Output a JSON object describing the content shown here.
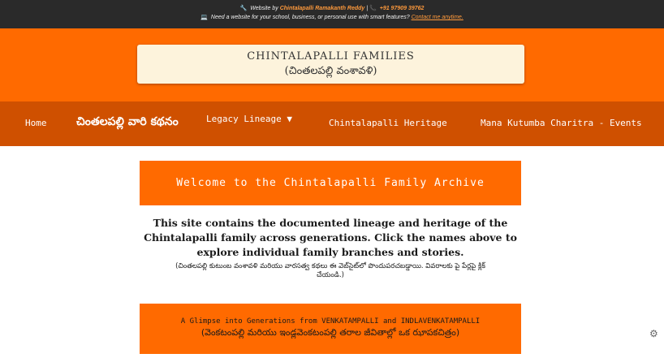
{
  "topbar": {
    "line1_icon": "wrench-icon",
    "line1_prefix": "Website by",
    "line1_author": "Chintalapalli Ramakanth Reddy",
    "line1_sep": "|",
    "line1_phone_icon": "phone-icon",
    "line1_phone": "+91 97909 39762",
    "line2_icon": "laptop-icon",
    "line2_text": "Need a website for your school, business, or personal use with smart features?",
    "line2_link": "Contact me anytime."
  },
  "header": {
    "title": "CHINTALAPALLI FAMILIES",
    "subtitle": "(చింతలపల్లి వంశావళి)"
  },
  "nav": {
    "home": "Home",
    "kathanam": "చింతలపల్లి వారి కథనం",
    "legacy": "Legacy Lineage ▼",
    "heritage": "Chintalapalli Heritage",
    "events": "Mana Kutumba Charitra - Events"
  },
  "welcome": {
    "title": "Welcome to the Chintalapalli Family Archive"
  },
  "intro": {
    "english": "This site contains the documented lineage and heritage of the Chintalapalli family across generations. Click the names above to explore individual family branches and stories.",
    "telugu": "(చింతలపల్లి కుటుంబ వంశావళి మరియు వారసత్వ కథలు ఈ వెబ్‌సైట్‌లో పొందుపరచబడ్డాయి. వివరాలకు పై పేర్లపై క్లిక్ చేయండి.)"
  },
  "glimpse": {
    "line1": "A Glimpse into Generations from VENKATAMPALLI and INDLAVENKATAMPALLI",
    "line2": "(వెంకటంపల్లి మరియు ఇండ్లవెంకటంపల్లి తరాల జీవితాల్లో ఒక ఝాపకచిత్రం)"
  },
  "colors": {
    "accent": "#ff6a00",
    "nav": "#cf5000",
    "topbar": "#2a2a2a",
    "title_box": "#fdf3dc"
  }
}
